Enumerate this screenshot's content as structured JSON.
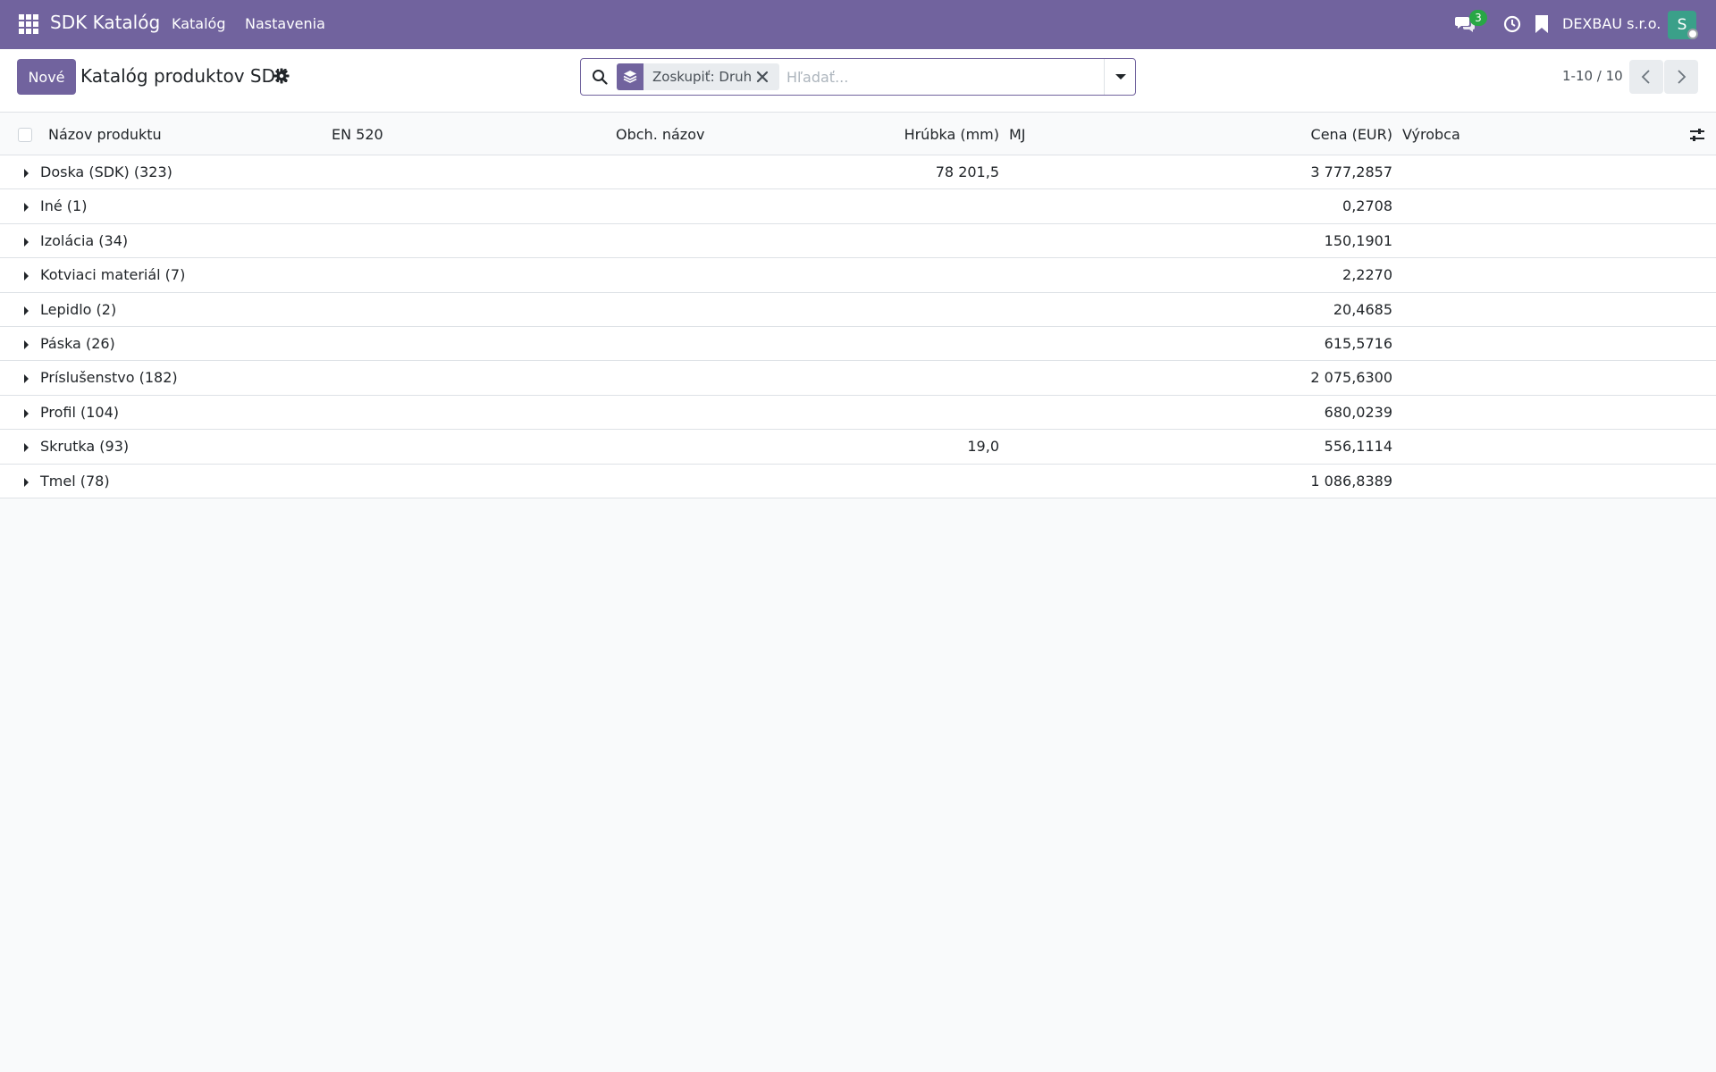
{
  "navbar": {
    "app_title": "SDK Katalóg",
    "menus": [
      "Katalóg",
      "Nastavenia"
    ],
    "messages_badge": "3",
    "company": "DEXBAU s.r.o.",
    "avatar_initial": "S",
    "accent_color": "#71639e",
    "icons": [
      "apps-grid-icon",
      "chat-icon",
      "clock-icon",
      "bookmark-icon"
    ]
  },
  "control_panel": {
    "new_label": "Nové",
    "title": "Katalóg produktov SDK",
    "search": {
      "facet_label": "Zoskupiť: Druh",
      "placeholder": "Hľadať..."
    },
    "pager": "1-10 / 10"
  },
  "list": {
    "columns": {
      "name": "Názov produktu",
      "en520": "EN 520",
      "trade_name": "Obch. názov",
      "thickness": "Hrúbka (mm)",
      "unit": "MJ",
      "price": "Cena (EUR)",
      "manufacturer": "Výrobca"
    },
    "groups": [
      {
        "name": "Doska (SDK) (323)",
        "thickness": "78 201,5",
        "price": "3 777,2857"
      },
      {
        "name": "Iné (1)",
        "thickness": "",
        "price": "0,2708"
      },
      {
        "name": "Izolácia (34)",
        "thickness": "",
        "price": "150,1901"
      },
      {
        "name": "Kotviaci materiál (7)",
        "thickness": "",
        "price": "2,2270"
      },
      {
        "name": "Lepidlo (2)",
        "thickness": "",
        "price": "20,4685"
      },
      {
        "name": "Páska (26)",
        "thickness": "",
        "price": "615,5716"
      },
      {
        "name": "Príslušenstvo (182)",
        "thickness": "",
        "price": "2 075,6300"
      },
      {
        "name": "Profil (104)",
        "thickness": "",
        "price": "680,0239"
      },
      {
        "name": "Skrutka (93)",
        "thickness": "19,0",
        "price": "556,1114"
      },
      {
        "name": "Tmel (78)",
        "thickness": "",
        "price": "1 086,8389"
      }
    ]
  }
}
